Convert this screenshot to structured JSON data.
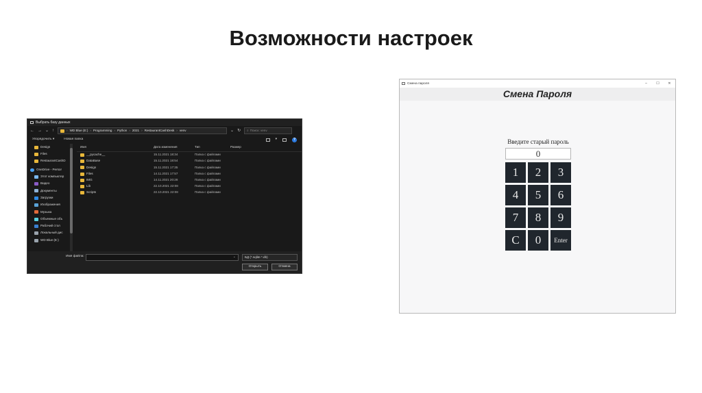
{
  "slide": {
    "title": "Возможности настроек"
  },
  "file_dialog": {
    "title": "Выбрать базу данных",
    "nav": {
      "back": "←",
      "forward": "→",
      "dropdown": "⌄",
      "up": "↑",
      "refresh": "↻",
      "path_dropdown": "⌄"
    },
    "breadcrumbs": [
      "WD Blue (E:)",
      "Programming",
      "Python",
      "2021",
      "RestaurantCashDesk",
      "venv"
    ],
    "crumb_sep": "›",
    "search_placeholder": "Поиск: venv",
    "search_icon": "⌕",
    "toolbar": {
      "organize": "Упорядочить ▾",
      "new_folder": "Новая папка",
      "view_caret": "▾",
      "help": "?"
    },
    "nav_pane": [
      {
        "label": "Design",
        "icon": "folder-icon",
        "color": "yellow"
      },
      {
        "label": "Files",
        "icon": "folder-icon",
        "color": "yellow"
      },
      {
        "label": "RestaurantCashD",
        "icon": "folder-icon",
        "color": "yellow"
      },
      {
        "label": "OneDrive - Persor",
        "icon": "cloud-icon",
        "color": "cloud"
      },
      {
        "label": "Этот компьютер",
        "icon": "computer-icon",
        "color": "pc"
      },
      {
        "label": "Видео",
        "icon": "video-icon",
        "color": "video"
      },
      {
        "label": "Документы",
        "icon": "documents-icon",
        "color": "doc"
      },
      {
        "label": "Загрузки",
        "icon": "downloads-icon",
        "color": "down"
      },
      {
        "label": "Изображения",
        "icon": "pictures-icon",
        "color": "img"
      },
      {
        "label": "Музыка",
        "icon": "music-icon",
        "color": "music"
      },
      {
        "label": "Объемные объ",
        "icon": "3d-objects-icon",
        "color": "3d"
      },
      {
        "label": "Рабочий стол",
        "icon": "desktop-icon",
        "color": "desk"
      },
      {
        "label": "Локальный дис",
        "icon": "disk-icon",
        "color": "disk"
      },
      {
        "label": "WD Blue (E:)",
        "icon": "disk-icon",
        "color": "disk"
      }
    ],
    "columns": {
      "name": "Имя",
      "date": "Дата изменения",
      "type": "Тип",
      "size": "Размер",
      "sort_arrow": "^"
    },
    "files": [
      {
        "name": "__pycache__",
        "date": "15.11.2021 18:34",
        "type": "Папка с файлами"
      },
      {
        "name": "DataBase",
        "date": "15.11.2021 18:54",
        "type": "Папка с файлами"
      },
      {
        "name": "Design",
        "date": "15.11.2021 17:35",
        "type": "Папка с файлами"
      },
      {
        "name": "Files",
        "date": "14.11.2021 17:57",
        "type": "Папка с файлами"
      },
      {
        "name": "IMG",
        "date": "14.11.2021 20:28",
        "type": "Папка с файлами"
      },
      {
        "name": "Lib",
        "date": "22.10.2021 22:08",
        "type": "Папка с файлами"
      },
      {
        "name": "Scripts",
        "date": "22.10.2021 22:08",
        "type": "Папка с файлами"
      }
    ],
    "bottom": {
      "filename_label": "Имя файла:",
      "filename_value": "",
      "filename_caret": "⌄",
      "filter": "БД (*.sqlite *.db)",
      "open_button": "Открыть",
      "cancel_button": "Отмена"
    }
  },
  "password_window": {
    "title": "Смена пароля",
    "controls": {
      "minimize": "–",
      "maximize": "☐",
      "close": "✕"
    },
    "header": "Смена Пароля",
    "prompt": "Введите старый пароль",
    "input_value": "0",
    "keys": [
      "1",
      "2",
      "3",
      "4",
      "5",
      "6",
      "7",
      "8",
      "9",
      "C",
      "0",
      "Enter"
    ]
  }
}
